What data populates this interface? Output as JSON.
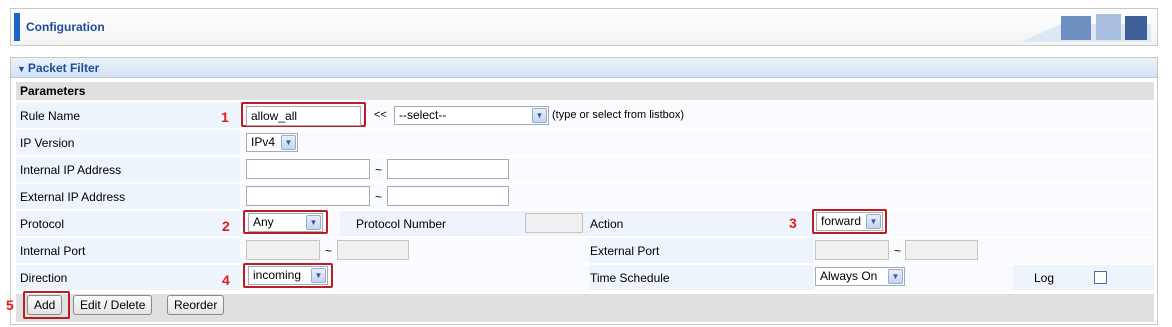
{
  "header": {
    "title": "Configuration"
  },
  "panel": {
    "title": "Packet Filter",
    "section": "Parameters"
  },
  "rows": {
    "rule_name": {
      "label": "Rule Name",
      "value": "allow_all",
      "arrows": "<<",
      "select": "--select--",
      "hint": "(type or select from listbox)"
    },
    "ip_version": {
      "label": "IP Version",
      "value": "IPv4"
    },
    "internal_ip": {
      "label": "Internal IP Address",
      "from": "",
      "to": "",
      "sep": "~"
    },
    "external_ip": {
      "label": "External IP Address",
      "from": "",
      "to": "",
      "sep": "~"
    },
    "protocol": {
      "label": "Protocol",
      "value": "Any",
      "number_label": "Protocol Number",
      "number_value": "",
      "action_label": "Action",
      "action_value": "forward"
    },
    "ports": {
      "label": "Internal Port",
      "from": "",
      "to": "",
      "sep": "~",
      "ext_label": "External Port",
      "ext_from": "",
      "ext_to": ""
    },
    "direction": {
      "label": "Direction",
      "value": "incoming",
      "schedule_label": "Time Schedule",
      "schedule_value": "Always On",
      "log_label": "Log"
    }
  },
  "buttons": {
    "add": "Add",
    "edit_delete": "Edit / Delete",
    "reorder": "Reorder"
  },
  "callouts": [
    "1",
    "2",
    "3",
    "4",
    "5"
  ],
  "colors": {
    "callout": "#e01e1e",
    "highlight_border": "#b81e24",
    "accent": "#1a66c8",
    "row_bg": "#eef4fb"
  }
}
